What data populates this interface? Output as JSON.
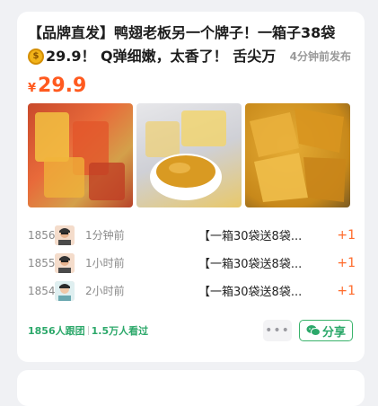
{
  "post": {
    "title_line1": "【品牌直发】鸭翅老板另一个牌子！一箱子38袋",
    "title_line2": "29.9！ Q弹细嫩，太香了！ 舌尖万",
    "posted_time": "4分钟前发布",
    "price_symbol": "¥",
    "price": "29.9"
  },
  "orders": [
    {
      "num": "1856",
      "time": "1分钟前",
      "product": "【一箱30袋送8袋...",
      "qty": "+1"
    },
    {
      "num": "1855",
      "time": "1小时前",
      "product": "【一箱30袋送8袋...",
      "qty": "+1"
    },
    {
      "num": "1854",
      "time": "2小时前",
      "product": "【一箱30袋送8袋...",
      "qty": "+1"
    }
  ],
  "footer": {
    "followers": "1856人跟团",
    "views": "1.5万人看过",
    "more_icon": "•••",
    "share_label": "分享"
  },
  "icons": {
    "coin": "coin-icon",
    "more": "more-dots-icon",
    "share": "wechat-icon"
  },
  "colors": {
    "price": "#ff5a1f",
    "accent_green": "#2ca86a",
    "plus": "#ff6a2a"
  }
}
